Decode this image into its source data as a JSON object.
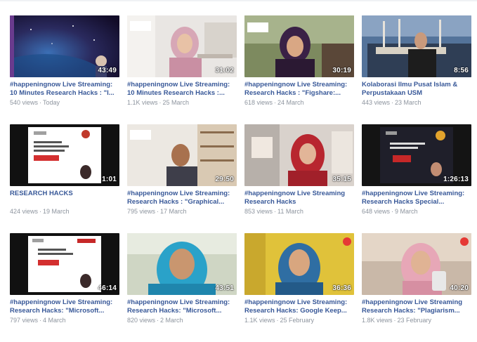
{
  "videos": [
    {
      "title": "#happeningnow Live Streaming:\n10 Minutes Research Hacks : \"I...",
      "views": "540 views",
      "date": "Today",
      "duration": "43:49",
      "thumb": "space"
    },
    {
      "title": "#happeningnow Live Streaming:\n10 Minutes Research Hacks :...",
      "views": "1.1K views",
      "date": "25 March",
      "duration": "31:02",
      "thumb": "office-pink"
    },
    {
      "title": "#happeningnow Live Streaming:\nResearch Hacks : \"Figshare:...",
      "views": "618 views",
      "date": "24 March",
      "duration": "30:19",
      "thumb": "purple-hijab"
    },
    {
      "title": "Kolaborasi Ilmu Pusat Islam &\nPerpustakaan USM",
      "views": "443 views",
      "date": "23 March",
      "duration": "8:56",
      "thumb": "mosque"
    },
    {
      "title": "RESEARCH HACKS",
      "views": "424 views",
      "date": "19 March",
      "duration": "1:01",
      "thumb": "slide-white"
    },
    {
      "title": "#happeningnow Live Streaming:\nResearch Hacks : \"Graphical...",
      "views": "795 views",
      "date": "17 March",
      "duration": "29:50",
      "thumb": "man-shelves"
    },
    {
      "title": "#happeningnow Live Streaming\nResearch Hacks",
      "views": "853 views",
      "date": "11 March",
      "duration": "35:15",
      "thumb": "red-hijab"
    },
    {
      "title": "#happeningnow Live Streaming:\nResearch Hacks Special...",
      "views": "648 views",
      "date": "9 March",
      "duration": "1:26:13",
      "thumb": "slide-dark"
    },
    {
      "title": "#happeningnow Live Streaming:\nResearch Hacks: \"Microsoft...",
      "views": "797 views",
      "date": "4 March",
      "duration": "46:14",
      "thumb": "slide-white2"
    },
    {
      "title": "#happeningnow Live Streaming:\nResearch Hacks: \"Microsoft...",
      "views": "820 views",
      "date": "2 March",
      "duration": "43:51",
      "thumb": "blue-hijab"
    },
    {
      "title": "#happeningnow Live Streaming:\nResearch Hacks: Google Keep...",
      "views": "1.1K views",
      "date": "25 February",
      "duration": "36:36",
      "thumb": "blue-hijab2"
    },
    {
      "title": "#happeningnow Live Streaming\nResearch Hacks: \"Plagiarism...",
      "views": "1.8K views",
      "date": "23 February",
      "duration": "40:20",
      "thumb": "pink-hijab"
    }
  ],
  "separator": "·",
  "colors": {
    "title": "#385898",
    "meta": "#8d949e"
  }
}
